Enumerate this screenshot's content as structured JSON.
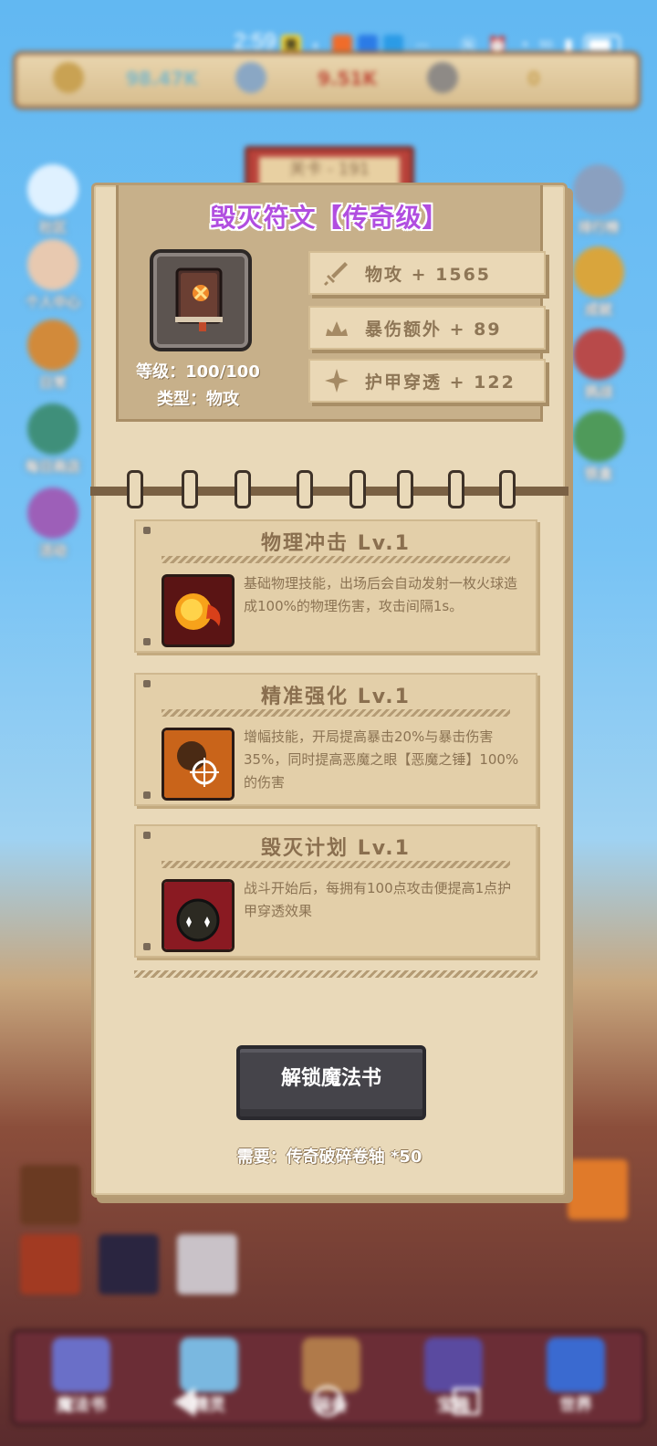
{
  "status_bar": {
    "time": "2:59",
    "app_badge": "美",
    "overflow": "···",
    "network": "5G"
  },
  "resources": [
    {
      "icon": "coin-icon",
      "value": "98.47K"
    },
    {
      "icon": "gem-icon",
      "value": "9.51K"
    },
    {
      "icon": "key-icon",
      "value": "0"
    }
  ],
  "level_banner": "关卡 - 191",
  "side_left": [
    "社区",
    "个人中心",
    "日常",
    "每日商店",
    "活动"
  ],
  "side_right": [
    "排行榜",
    "成就",
    "挑战",
    "铁盒"
  ],
  "modal": {
    "title": "毁灭符文【传奇级】",
    "item": {
      "level": "等级：100/100",
      "type": "类型：物攻"
    },
    "stats": [
      {
        "icon": "sword-icon",
        "text": "物攻 + 1565"
      },
      {
        "icon": "crown-burst-icon",
        "text": "暴伤额外 + 89"
      },
      {
        "icon": "sparkle-icon",
        "text": "护甲穿透 + 122"
      }
    ],
    "skills": [
      {
        "name": "物理冲击 Lv.1",
        "desc": "基础物理技能，出场后会自动发射一枚火球造成100%的物理伤害，攻击间隔1s。",
        "icon": "fireball-icon"
      },
      {
        "name": "精准强化 Lv.1",
        "desc": "增幅技能，开局提高暴击20%与暴击伤害35%，同时提高恶魔之眼【恶魔之锤】100%的伤害",
        "icon": "target-icon"
      },
      {
        "name": "毁灭计划 Lv.1",
        "desc": "战斗开始后，每拥有100点攻击便提高1点护甲穿透效果",
        "icon": "dark-orb-icon"
      }
    ],
    "unlock_button": "解锁魔法书",
    "requirement": "需要：传奇破碎卷轴 *50"
  },
  "bottom_nav": [
    "魔法书",
    "精灵",
    "装备",
    "宝箱",
    "世界"
  ],
  "colors": {
    "title_purple": "#b14ee0",
    "parchment": "#e9d9b9",
    "button_dark": "#45444a"
  }
}
